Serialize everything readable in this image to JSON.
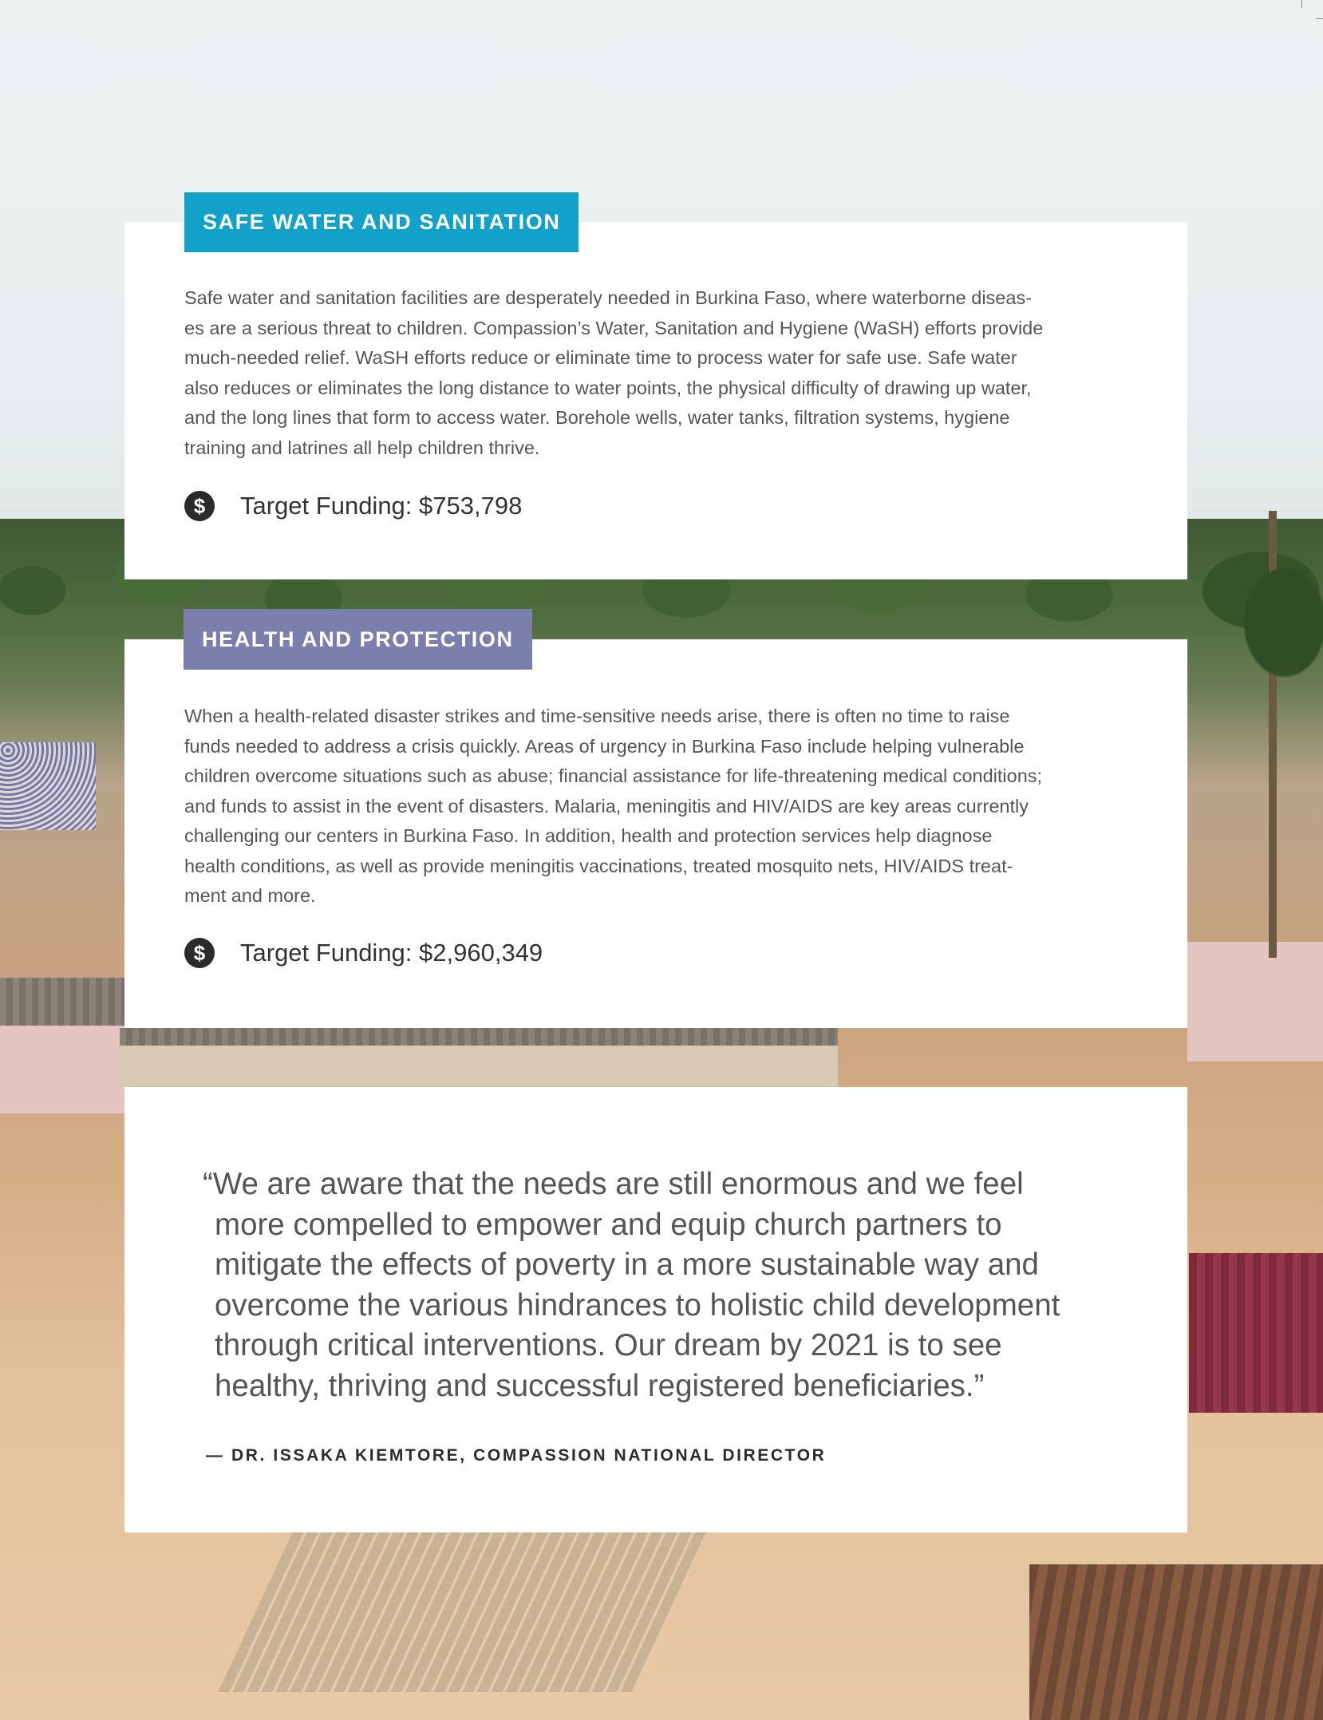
{
  "sections": {
    "water": {
      "tag": "SAFE WATER AND SANITATION",
      "lines": [
        "Safe water and sanitation facilities are desperately needed in Burkina Faso, where waterborne diseas-",
        "es are a serious threat to children. Compassion’s Water, Sanitation and Hygiene (WaSH) efforts provide",
        "much-needed relief. WaSH efforts reduce or eliminate time to process water for safe use. Safe water",
        "also reduces or eliminates the long distance to water points, the physical difficulty of drawing up water,",
        "and the long lines that form to access water. Borehole wells, water tanks, filtration systems, hygiene",
        "training and latrines all help children thrive."
      ],
      "funding": "Target Funding: $753,798",
      "tag_color": "#12a2c9"
    },
    "health": {
      "tag": "HEALTH AND PROTECTION",
      "lines": [
        "When a health-related disaster strikes and time-sensitive needs arise, there is often no time to raise",
        "funds needed to address a crisis quickly. Areas of urgency in Burkina Faso include helping vulnerable",
        "children overcome situations such as abuse; financial assistance for life-threatening medical conditions;",
        "and funds to assist in the event of disasters. Malaria, meningitis and HIV/AIDS are key areas currently",
        "challenging our centers in Burkina Faso. In addition, health and protection services help diagnose",
        "health conditions, as well as provide meningitis vaccinations, treated mosquito nets, HIV/AIDS treat-",
        "ment and more."
      ],
      "funding": "Target Funding: $2,960,349",
      "tag_color": "#7b7fac"
    }
  },
  "dollar_icon": "dollar-sign-icon",
  "dollar_glyph": "$",
  "quote": {
    "lines": [
      "“We are aware that the needs are still enormous and we feel",
      "more compelled to empower and equip church partners to",
      "mitigate the effects of poverty in a more sustainable way and",
      "overcome the various hindrances to holistic child development",
      "through critical interventions. Our dream by 2021 is to see",
      "healthy, thriving and successful registered beneficiaries.”"
    ],
    "attribution": "— DR. ISSAKA KIEMTORE, COMPASSION NATIONAL DIRECTOR"
  }
}
